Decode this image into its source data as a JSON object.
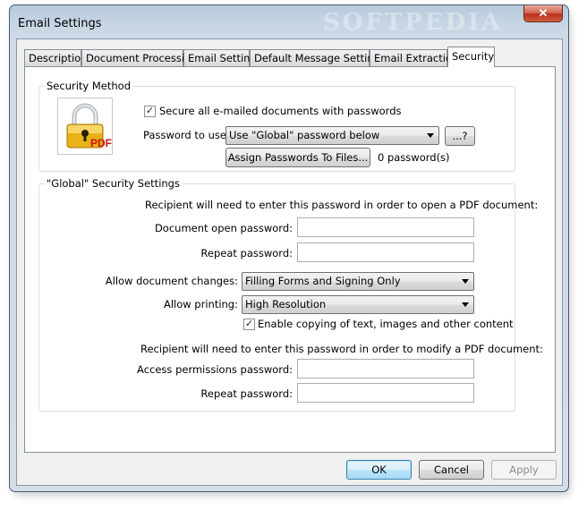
{
  "window": {
    "title": "Email Settings",
    "watermark": "SOFTPEDIA",
    "close_glyph": "✕"
  },
  "tabs": [
    {
      "label": "Description"
    },
    {
      "label": "Document Processing"
    },
    {
      "label": "Email Setting"
    },
    {
      "label": "Default Message Settings"
    },
    {
      "label": "Email Extraction"
    },
    {
      "label": "Security",
      "active": true
    }
  ],
  "security_method": {
    "group_label": "Security Method",
    "icon": "lock-pdf-icon",
    "icon_badge": "PDF",
    "secure_checkbox_label": "Secure all e-mailed documents with passwords",
    "secure_checked": true,
    "password_to_use_label": "Password to use:",
    "password_to_use_value": "Use \"Global\" password below",
    "help_button_label": "...?",
    "assign_button_label": "Assign Passwords To Files...",
    "password_count": "0 password(s)"
  },
  "global_settings": {
    "group_label": "\"Global\" Security Settings",
    "open_intro": "Recipient will need to enter this password  in order to open a PDF document:",
    "open_password_label": "Document open password:",
    "open_password_value": "",
    "repeat_password_label": "Repeat password:",
    "repeat_password_value": "",
    "allow_changes_label": "Allow document changes:",
    "allow_changes_value": "Filling Forms and Signing Only",
    "allow_printing_label": "Allow printing:",
    "allow_printing_value": "High Resolution",
    "copy_checkbox_label": "Enable copying of text, images and other content",
    "copy_checked": true,
    "modify_intro": "Recipient will need to enter this password in order to modify a PDF document:",
    "access_password_label": "Access permissions password:",
    "access_password_value": "",
    "repeat_password2_label": "Repeat password:",
    "repeat_password2_value": ""
  },
  "buttons": {
    "ok": "OK",
    "cancel": "Cancel",
    "apply": "Apply"
  },
  "colors": {
    "accent_default_button": "#3c7fb1",
    "close_button": "#c9452f",
    "lock_gold": "#e8b21a",
    "pdf_badge": "#cc1111"
  }
}
